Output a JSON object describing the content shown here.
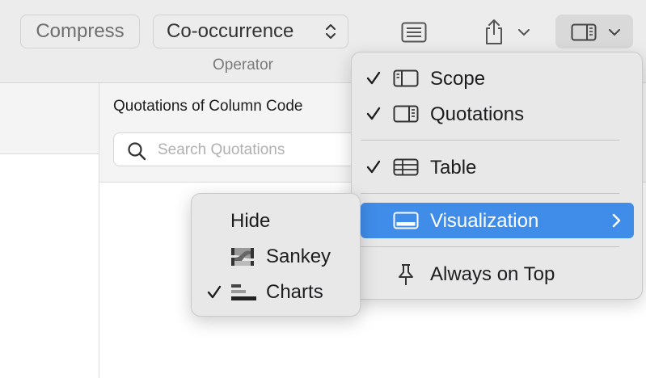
{
  "toolbar": {
    "compress_label": "Compress",
    "operator_value": "Co-occurrence",
    "operator_label": "Operator"
  },
  "quotations": {
    "title": "Quotations of Column Code",
    "search_placeholder": "Search Quotations"
  },
  "view_menu": {
    "items": [
      {
        "label": "Scope",
        "checked": true,
        "icon": "sidebar-left-icon"
      },
      {
        "label": "Quotations",
        "checked": true,
        "icon": "sidebar-right-icon"
      },
      {
        "label": "Table",
        "checked": true,
        "icon": "table-icon"
      },
      {
        "label": "Visualization",
        "checked": false,
        "icon": "bottom-panel-icon",
        "highlighted": true,
        "has_submenu": true
      },
      {
        "label": "Always on Top",
        "checked": false,
        "icon": "pin-icon"
      }
    ]
  },
  "visualization_submenu": {
    "items": [
      {
        "label": "Hide",
        "checked": false
      },
      {
        "label": "Sankey",
        "checked": false,
        "icon": "sankey-icon"
      },
      {
        "label": "Charts",
        "checked": true,
        "icon": "bar-chart-icon"
      }
    ]
  },
  "colors": {
    "highlight": "#3f8ce9",
    "toolbar_bg": "#ececec",
    "menu_bg": "#e8e8e8"
  }
}
